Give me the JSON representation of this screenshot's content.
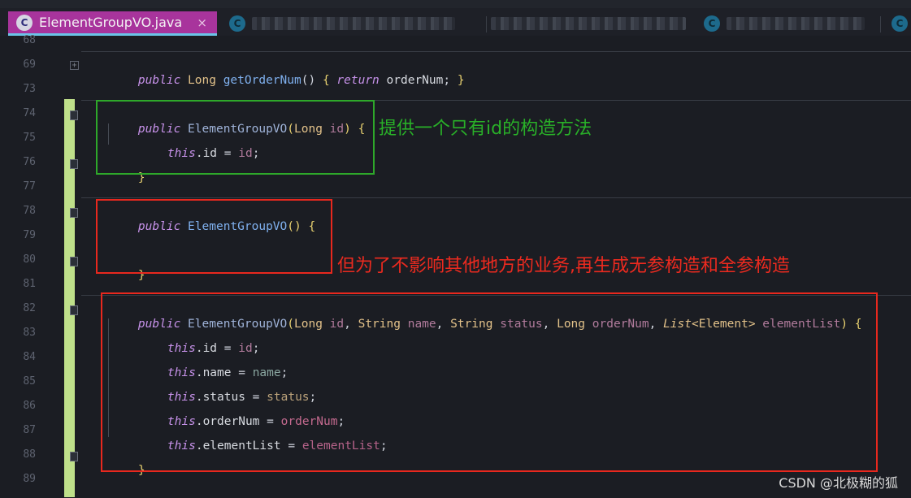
{
  "tabs": {
    "active": {
      "icon_letter": "C",
      "label": "ElementGroupVO.java",
      "close": "×"
    },
    "inactive_icon_letter": "C"
  },
  "line_numbers": [
    "68",
    "69",
    "73",
    "74",
    "75",
    "76",
    "77",
    "78",
    "79",
    "80",
    "81",
    "82",
    "83",
    "84",
    "85",
    "86",
    "87",
    "88",
    "89"
  ],
  "code": {
    "l69": {
      "kw": "public",
      "type": "Long",
      "fn": "getOrderNum",
      "rest1": "() ",
      "brace1": "{",
      "kw2": "return",
      "field": "orderNum",
      "rest2": "; ",
      "brace2": "}"
    },
    "l74": {
      "kw": "public",
      "ctor": "ElementGroupVO",
      "p1": "(",
      "type": "Long",
      "param": "id",
      "p2": ") ",
      "brace": "{"
    },
    "l75": {
      "kw": "this",
      "field": ".id",
      "eq": " = ",
      "param": "id",
      "end": ";"
    },
    "l76": {
      "brace": "}"
    },
    "l78": {
      "kw": "public",
      "ctor": "ElementGroupVO",
      "p": "() ",
      "brace": "{"
    },
    "l80": {
      "brace": "}"
    },
    "l82": {
      "kw": "public",
      "ctor": "ElementGroupVO",
      "p1": "(",
      "t1": "Long",
      "a1": "id",
      "c1": ", ",
      "t2": "String",
      "a2": "name",
      "c2": ", ",
      "t3": "String",
      "a3": "status",
      "c3": ", ",
      "t4": "Long",
      "a4": "orderNum",
      "c4": ", ",
      "t5": "List",
      "g1": "<Element>",
      "a5": "elementList",
      "p2": ") ",
      "brace": "{"
    },
    "l83": {
      "kw": "this",
      "field": ".id",
      "eq": " = ",
      "param": "id",
      "end": ";"
    },
    "l84": {
      "kw": "this",
      "field": ".name",
      "eq": " = ",
      "param": "name",
      "end": ";"
    },
    "l85": {
      "kw": "this",
      "field": ".status",
      "eq": " = ",
      "param": "status",
      "end": ";"
    },
    "l86": {
      "kw": "this",
      "field": ".orderNum",
      "eq": " = ",
      "param": "orderNum",
      "end": ";"
    },
    "l87": {
      "kw": "this",
      "field": ".elementList",
      "eq": " = ",
      "param": "elementList",
      "end": ";"
    },
    "l88": {
      "brace": "}"
    }
  },
  "annotations": {
    "green_note": "提供一个只有id的构造方法",
    "red_note": "但为了不影响其他地方的业务,再生成无参构造和全参构造"
  },
  "watermark": "CSDN @北极糊的狐",
  "colors": {
    "keyword": "#c792ea",
    "type": "#e3c28a",
    "method": "#7fb0ee",
    "param": "#b17b9c",
    "green_box": "#2ea82a",
    "red_box": "#e8281e",
    "tab_active": "#a8349c",
    "change_bar": "#bfe08a"
  }
}
